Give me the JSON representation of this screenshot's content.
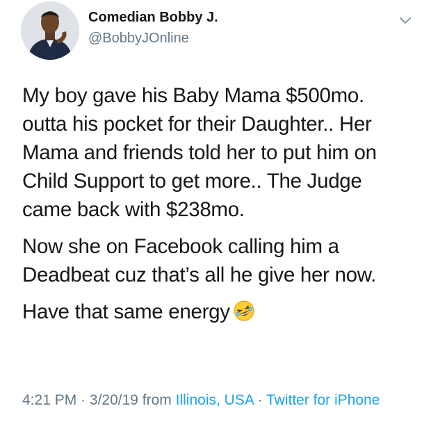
{
  "author": {
    "name": "Comedian Bobby J.",
    "handle": "@BobbyJOnline"
  },
  "tweet": {
    "line1": "My boy gave his Baby Mama $500mo.",
    "line2": "outta his pocket for their Daughter.. Her",
    "line3": "Mama and friends told her to put him on",
    "line4": "Child Support to get more.. The Judge",
    "line5": "came back with $238mo.",
    "para2_line1": "Now she on Facebook calling him a",
    "para2_line2": "Deadbeat cuz that’s all he give her now.",
    "para3": "Have that same energy",
    "emoji_name": "rolling-on-the-floor-laughing-emoji"
  },
  "meta": {
    "time": "4:21 PM",
    "sep1": " · ",
    "date": "3/20/19",
    "from": " from ",
    "location": "Illinois, USA",
    "sep2": " · ",
    "source": "Twitter for iPhone"
  },
  "icons": {
    "caret": "chevron-down-icon"
  },
  "colors": {
    "text": "#14171a",
    "secondary": "#657786",
    "link": "#1da1f2"
  }
}
